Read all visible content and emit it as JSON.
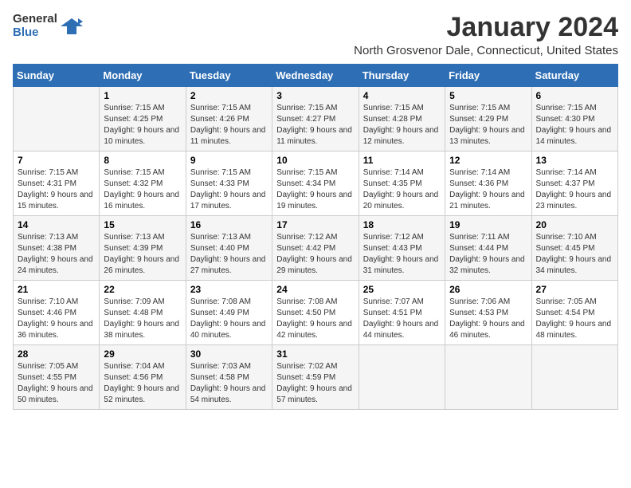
{
  "logo": {
    "line1": "General",
    "line2": "Blue"
  },
  "title": "January 2024",
  "subtitle": "North Grosvenor Dale, Connecticut, United States",
  "days_of_week": [
    "Sunday",
    "Monday",
    "Tuesday",
    "Wednesday",
    "Thursday",
    "Friday",
    "Saturday"
  ],
  "weeks": [
    [
      {
        "day": "",
        "sunrise": "",
        "sunset": "",
        "daylight": ""
      },
      {
        "day": "1",
        "sunrise": "Sunrise: 7:15 AM",
        "sunset": "Sunset: 4:25 PM",
        "daylight": "Daylight: 9 hours and 10 minutes."
      },
      {
        "day": "2",
        "sunrise": "Sunrise: 7:15 AM",
        "sunset": "Sunset: 4:26 PM",
        "daylight": "Daylight: 9 hours and 11 minutes."
      },
      {
        "day": "3",
        "sunrise": "Sunrise: 7:15 AM",
        "sunset": "Sunset: 4:27 PM",
        "daylight": "Daylight: 9 hours and 11 minutes."
      },
      {
        "day": "4",
        "sunrise": "Sunrise: 7:15 AM",
        "sunset": "Sunset: 4:28 PM",
        "daylight": "Daylight: 9 hours and 12 minutes."
      },
      {
        "day": "5",
        "sunrise": "Sunrise: 7:15 AM",
        "sunset": "Sunset: 4:29 PM",
        "daylight": "Daylight: 9 hours and 13 minutes."
      },
      {
        "day": "6",
        "sunrise": "Sunrise: 7:15 AM",
        "sunset": "Sunset: 4:30 PM",
        "daylight": "Daylight: 9 hours and 14 minutes."
      }
    ],
    [
      {
        "day": "7",
        "sunrise": "Sunrise: 7:15 AM",
        "sunset": "Sunset: 4:31 PM",
        "daylight": "Daylight: 9 hours and 15 minutes."
      },
      {
        "day": "8",
        "sunrise": "Sunrise: 7:15 AM",
        "sunset": "Sunset: 4:32 PM",
        "daylight": "Daylight: 9 hours and 16 minutes."
      },
      {
        "day": "9",
        "sunrise": "Sunrise: 7:15 AM",
        "sunset": "Sunset: 4:33 PM",
        "daylight": "Daylight: 9 hours and 17 minutes."
      },
      {
        "day": "10",
        "sunrise": "Sunrise: 7:15 AM",
        "sunset": "Sunset: 4:34 PM",
        "daylight": "Daylight: 9 hours and 19 minutes."
      },
      {
        "day": "11",
        "sunrise": "Sunrise: 7:14 AM",
        "sunset": "Sunset: 4:35 PM",
        "daylight": "Daylight: 9 hours and 20 minutes."
      },
      {
        "day": "12",
        "sunrise": "Sunrise: 7:14 AM",
        "sunset": "Sunset: 4:36 PM",
        "daylight": "Daylight: 9 hours and 21 minutes."
      },
      {
        "day": "13",
        "sunrise": "Sunrise: 7:14 AM",
        "sunset": "Sunset: 4:37 PM",
        "daylight": "Daylight: 9 hours and 23 minutes."
      }
    ],
    [
      {
        "day": "14",
        "sunrise": "Sunrise: 7:13 AM",
        "sunset": "Sunset: 4:38 PM",
        "daylight": "Daylight: 9 hours and 24 minutes."
      },
      {
        "day": "15",
        "sunrise": "Sunrise: 7:13 AM",
        "sunset": "Sunset: 4:39 PM",
        "daylight": "Daylight: 9 hours and 26 minutes."
      },
      {
        "day": "16",
        "sunrise": "Sunrise: 7:13 AM",
        "sunset": "Sunset: 4:40 PM",
        "daylight": "Daylight: 9 hours and 27 minutes."
      },
      {
        "day": "17",
        "sunrise": "Sunrise: 7:12 AM",
        "sunset": "Sunset: 4:42 PM",
        "daylight": "Daylight: 9 hours and 29 minutes."
      },
      {
        "day": "18",
        "sunrise": "Sunrise: 7:12 AM",
        "sunset": "Sunset: 4:43 PM",
        "daylight": "Daylight: 9 hours and 31 minutes."
      },
      {
        "day": "19",
        "sunrise": "Sunrise: 7:11 AM",
        "sunset": "Sunset: 4:44 PM",
        "daylight": "Daylight: 9 hours and 32 minutes."
      },
      {
        "day": "20",
        "sunrise": "Sunrise: 7:10 AM",
        "sunset": "Sunset: 4:45 PM",
        "daylight": "Daylight: 9 hours and 34 minutes."
      }
    ],
    [
      {
        "day": "21",
        "sunrise": "Sunrise: 7:10 AM",
        "sunset": "Sunset: 4:46 PM",
        "daylight": "Daylight: 9 hours and 36 minutes."
      },
      {
        "day": "22",
        "sunrise": "Sunrise: 7:09 AM",
        "sunset": "Sunset: 4:48 PM",
        "daylight": "Daylight: 9 hours and 38 minutes."
      },
      {
        "day": "23",
        "sunrise": "Sunrise: 7:08 AM",
        "sunset": "Sunset: 4:49 PM",
        "daylight": "Daylight: 9 hours and 40 minutes."
      },
      {
        "day": "24",
        "sunrise": "Sunrise: 7:08 AM",
        "sunset": "Sunset: 4:50 PM",
        "daylight": "Daylight: 9 hours and 42 minutes."
      },
      {
        "day": "25",
        "sunrise": "Sunrise: 7:07 AM",
        "sunset": "Sunset: 4:51 PM",
        "daylight": "Daylight: 9 hours and 44 minutes."
      },
      {
        "day": "26",
        "sunrise": "Sunrise: 7:06 AM",
        "sunset": "Sunset: 4:53 PM",
        "daylight": "Daylight: 9 hours and 46 minutes."
      },
      {
        "day": "27",
        "sunrise": "Sunrise: 7:05 AM",
        "sunset": "Sunset: 4:54 PM",
        "daylight": "Daylight: 9 hours and 48 minutes."
      }
    ],
    [
      {
        "day": "28",
        "sunrise": "Sunrise: 7:05 AM",
        "sunset": "Sunset: 4:55 PM",
        "daylight": "Daylight: 9 hours and 50 minutes."
      },
      {
        "day": "29",
        "sunrise": "Sunrise: 7:04 AM",
        "sunset": "Sunset: 4:56 PM",
        "daylight": "Daylight: 9 hours and 52 minutes."
      },
      {
        "day": "30",
        "sunrise": "Sunrise: 7:03 AM",
        "sunset": "Sunset: 4:58 PM",
        "daylight": "Daylight: 9 hours and 54 minutes."
      },
      {
        "day": "31",
        "sunrise": "Sunrise: 7:02 AM",
        "sunset": "Sunset: 4:59 PM",
        "daylight": "Daylight: 9 hours and 57 minutes."
      },
      {
        "day": "",
        "sunrise": "",
        "sunset": "",
        "daylight": ""
      },
      {
        "day": "",
        "sunrise": "",
        "sunset": "",
        "daylight": ""
      },
      {
        "day": "",
        "sunrise": "",
        "sunset": "",
        "daylight": ""
      }
    ]
  ]
}
